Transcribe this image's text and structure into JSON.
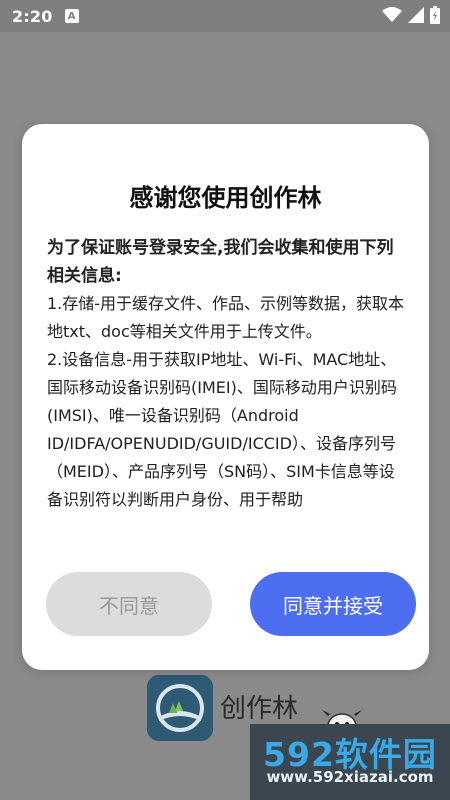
{
  "statusbar": {
    "time": "2:20",
    "notification": "A"
  },
  "dialog": {
    "title": "感谢您使用创作林",
    "lead": "为了保证账号登录安全,我们会收集和使用下列相关信息:",
    "items": [
      "1.存储-用于缓存文件、作品、示例等数据，获取本地txt、doc等相关文件用于上传文件。",
      "2.设备信息-用于获取IP地址、Wi-Fi、MAC地址、国际移动设备识别码(IMEI)、国际移动用户识别码(IMSI)、唯一设备识别码（Android ID/IDFA/OPENUDID/GUID/ICCID）、设备序列号（MEID）、产品序列号（SN码）、SIM卡信息等设备识别符以判断用户身份、用于帮助"
    ],
    "disagree_label": "不同意",
    "agree_label": "同意并接受"
  },
  "splash": {
    "app_name": "创作林"
  },
  "watermark": {
    "logo_text": "592软件园",
    "url": "www.592xiazai.com"
  },
  "colors": {
    "agree_button": "#4e6ef2",
    "disagree_button": "#dcdcdc"
  }
}
